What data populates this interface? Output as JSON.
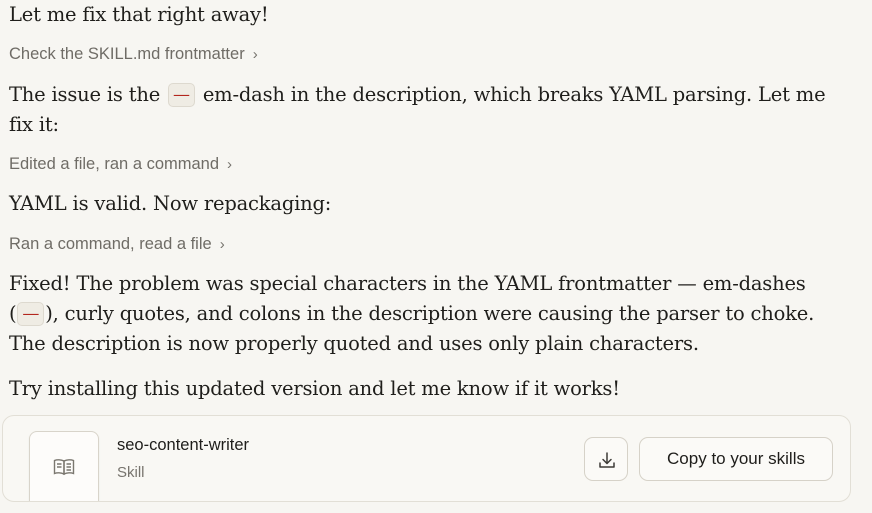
{
  "messages": {
    "m1": "Let me fix that right away!",
    "m2_before": "The issue is the",
    "m2_code": "—",
    "m2_after": "em-dash in the description, which breaks YAML parsing. Let me fix it:",
    "m3": "YAML is valid. Now repackaging:",
    "m4_part1": "Fixed! The problem was special characters in the YAML frontmatter — em-dashes (",
    "m4_code": "—",
    "m4_part2": "), curly quotes, and colons in the description were causing the parser to choke. The description is now properly quoted and uses only plain characters.",
    "m5": "Try installing this updated version and let me know if it works!"
  },
  "steps": {
    "s1": "Check the SKILL.md frontmatter",
    "s2": "Edited a file, ran a command",
    "s3": "Ran a command, read a file",
    "chevron": "›"
  },
  "artifact": {
    "name": "seo-content-writer",
    "type": "Skill",
    "copy_label": "Copy to your skills",
    "icon": "book-icon",
    "download_icon": "download-icon"
  }
}
